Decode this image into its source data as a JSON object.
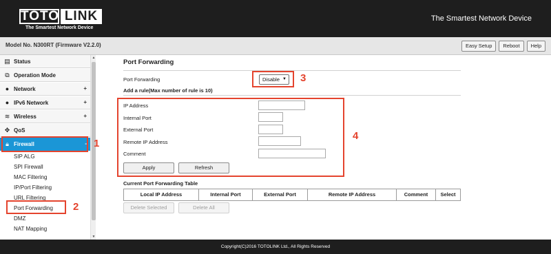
{
  "header": {
    "logo_left": "TOTO",
    "logo_right": "LINK",
    "logo_tagline": "The Smartest Network Device",
    "tagline": "The Smartest Network Device"
  },
  "modelbar": {
    "model": "Model No. N300RT (Firmware V2.2.0)",
    "buttons": {
      "easy_setup": "Easy Setup",
      "reboot": "Reboot",
      "help": "Help"
    }
  },
  "sidebar": {
    "items": [
      {
        "label": "Status",
        "icon": "status-icon",
        "expander": ""
      },
      {
        "label": "Operation Mode",
        "icon": "operation-mode-icon",
        "expander": ""
      },
      {
        "label": "Network",
        "icon": "globe-icon",
        "expander": "+"
      },
      {
        "label": "IPv6 Network",
        "icon": "globe-icon",
        "expander": "+"
      },
      {
        "label": "Wireless",
        "icon": "wifi-icon",
        "expander": "+"
      },
      {
        "label": "QoS",
        "icon": "qos-icon",
        "expander": ""
      },
      {
        "label": "Firewall",
        "icon": "lock-icon",
        "expander": "-"
      }
    ],
    "subitems": [
      "SIP ALG",
      "SPI Firewall",
      "MAC Filtering",
      "IP/Port Filtering",
      "URL Filtering",
      "Port Forwarding",
      "DMZ",
      "NAT Mapping"
    ],
    "active_item": "Firewall",
    "active_subitem": "Port Forwarding"
  },
  "main": {
    "title": "Port Forwarding",
    "port_forwarding_label": "Port Forwarding",
    "port_forwarding_value": "Disable",
    "add_rule_label": "Add a rule(Max number of rule is 10)",
    "fields": {
      "ip_address": {
        "label": "IP Address",
        "value": ""
      },
      "internal_port": {
        "label": "Internal Port",
        "value": ""
      },
      "external_port": {
        "label": "External Port",
        "value": ""
      },
      "remote_ip": {
        "label": "Remote IP Address",
        "value": ""
      },
      "comment": {
        "label": "Comment",
        "value": ""
      }
    },
    "apply_label": "Apply",
    "refresh_label": "Refresh",
    "table_title": "Current Port Forwarding Table",
    "table_headers": [
      "Local IP Address",
      "Internal Port",
      "External Port",
      "Remote IP Address",
      "Comment",
      "Select"
    ],
    "delete_selected_label": "Delete Selected",
    "delete_all_label": "Delete All"
  },
  "callouts": [
    "1",
    "2",
    "3",
    "4"
  ],
  "colors": {
    "accent": "#1b96d6",
    "callout": "#e4432d",
    "header": "#1e1e1e"
  },
  "footer": {
    "copyright": "Copyright(C)2016 TOTOLINK Ltd., All Rights Reserved"
  }
}
